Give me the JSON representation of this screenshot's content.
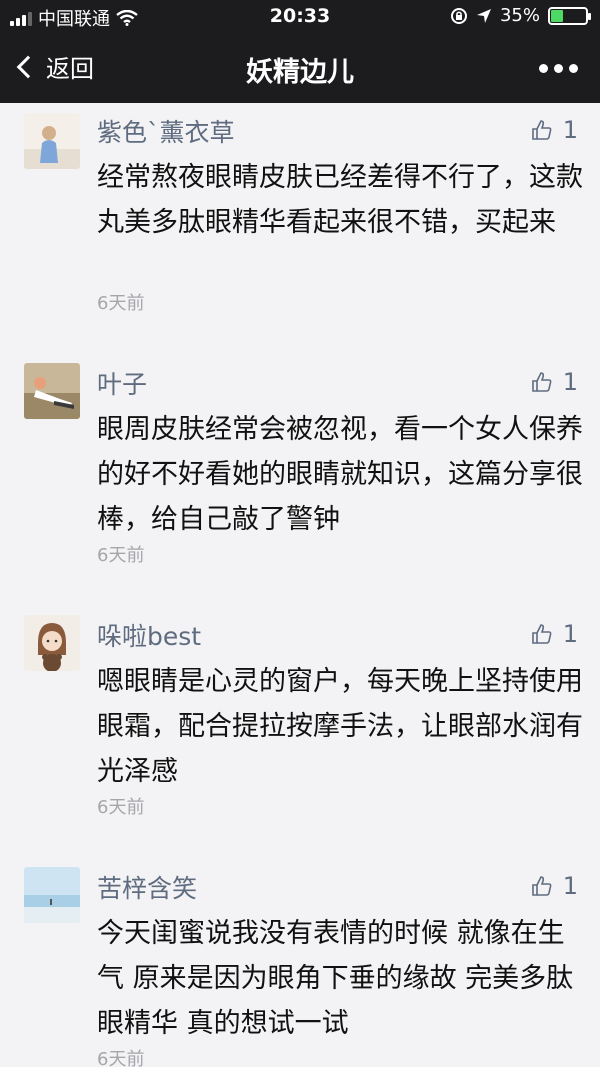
{
  "status": {
    "carrier": "中国联通",
    "time": "20:33",
    "battery": "35%",
    "battery_level": 0.35
  },
  "nav": {
    "back_label": "返回",
    "title": "妖精边儿"
  },
  "comments": [
    {
      "name": "紫色`薰衣草",
      "likes": "1",
      "text": "经常熬夜眼睛皮肤已经差得不行了，这款丸美多肽眼精华看起来很不错，买起来",
      "time": "6天前"
    },
    {
      "name": "叶子",
      "likes": "1",
      "text": "眼周皮肤经常会被忽视，看一个女人保养的好不好看她的眼睛就知识，这篇分享很棒，给自己敲了警钟",
      "time": "6天前"
    },
    {
      "name": "哚啦best",
      "likes": "1",
      "text": "嗯眼睛是心灵的窗户，每天晚上坚持使用眼霜，配合提拉按摩手法，让眼部水润有光泽感",
      "time": "6天前"
    },
    {
      "name": "苦梓含笑",
      "likes": "1",
      "text": "今天闺蜜说我没有表情的时候 就像在生气 原来是因为眼角下垂的缘故 完美多肽眼精华 真的想试一试",
      "time": "6天前"
    }
  ]
}
